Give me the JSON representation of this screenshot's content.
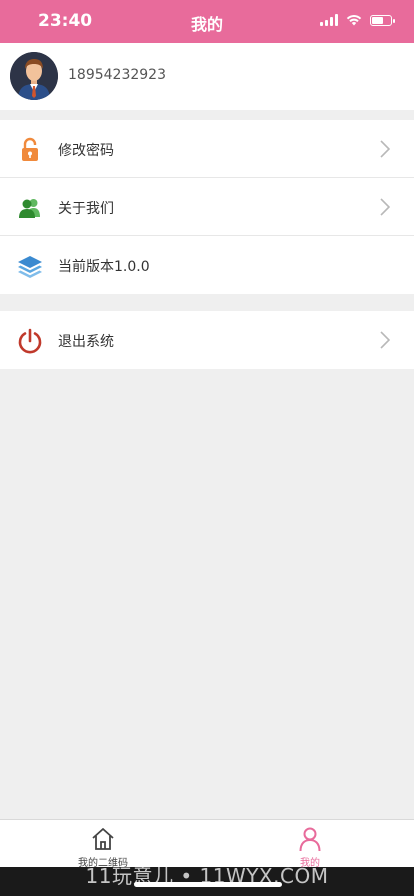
{
  "status_bar": {
    "time": "23:40"
  },
  "header": {
    "title": "我的"
  },
  "profile": {
    "phone": "18954232923"
  },
  "menu_group_1": [
    {
      "label": "修改密码",
      "icon": "lock-icon"
    },
    {
      "label": "关于我们",
      "icon": "users-icon"
    },
    {
      "label": "当前版本1.0.0",
      "icon": "layers-icon"
    }
  ],
  "menu_group_2": [
    {
      "label": "退出系统",
      "icon": "power-icon"
    }
  ],
  "tabbar": {
    "items": [
      {
        "label": "我的二维码",
        "icon": "home-icon"
      },
      {
        "label": "我的",
        "icon": "person-icon",
        "active": true
      }
    ]
  },
  "watermark": "11玩意儿 • 11WYX.COM",
  "colors": {
    "accent": "#e86b9b",
    "lock": "#f08a3c",
    "users": "#3a9a3a",
    "layers": "#3a8ad0",
    "power": "#c0392b"
  }
}
